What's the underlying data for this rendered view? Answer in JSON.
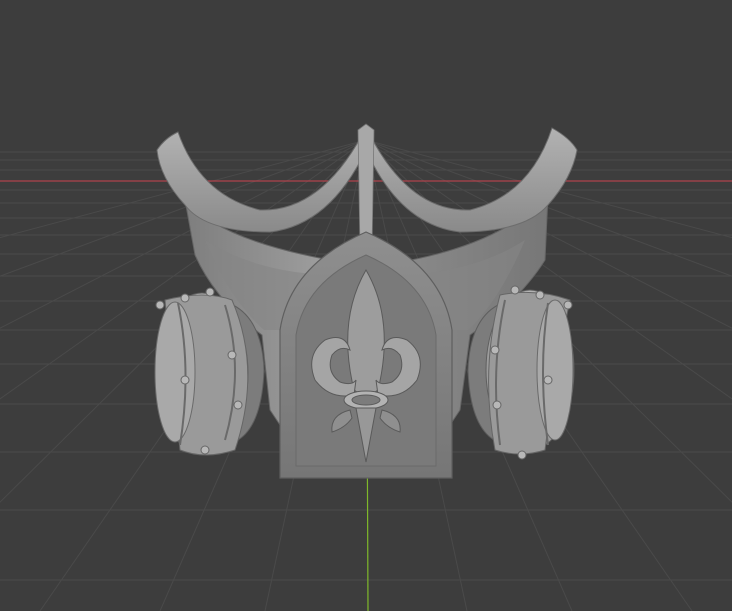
{
  "viewport": {
    "background": "#3d3d3d",
    "grid_color": "#4a4a4a",
    "x_axis_color": "#b0434c",
    "y_axis_color": "#7fb82a"
  },
  "model": {
    "object": "gas-mask",
    "material_color": "#8e8e8e",
    "emblem": "fleur-de-lis",
    "filter_canisters": 2
  }
}
